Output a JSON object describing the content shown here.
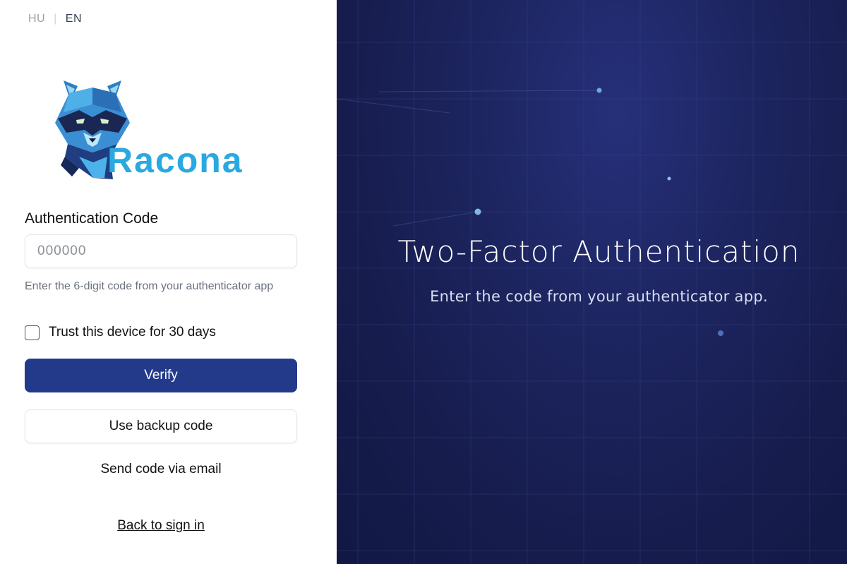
{
  "language": {
    "hu": "HU",
    "en": "EN",
    "separator": "|",
    "active": "EN"
  },
  "brand": {
    "name": "Racona",
    "colors": {
      "primary": "#233a8b",
      "logo_blue": "#2aa8e0"
    }
  },
  "form": {
    "code_label": "Authentication Code",
    "code_placeholder": "000000",
    "code_value": "",
    "hint": "Enter the 6-digit code from your authenticator app",
    "trust_label": "Trust this device for 30 days",
    "trust_checked": false,
    "verify_label": "Verify",
    "backup_label": "Use backup code",
    "email_label": "Send code via email",
    "back_label": "Back to sign in"
  },
  "hero": {
    "title": "Two-Factor Authentication",
    "subtitle": "Enter the code from your authenticator app."
  },
  "icons": {
    "logo": "raccoon-logo-icon",
    "checkbox": "checkbox-icon"
  }
}
